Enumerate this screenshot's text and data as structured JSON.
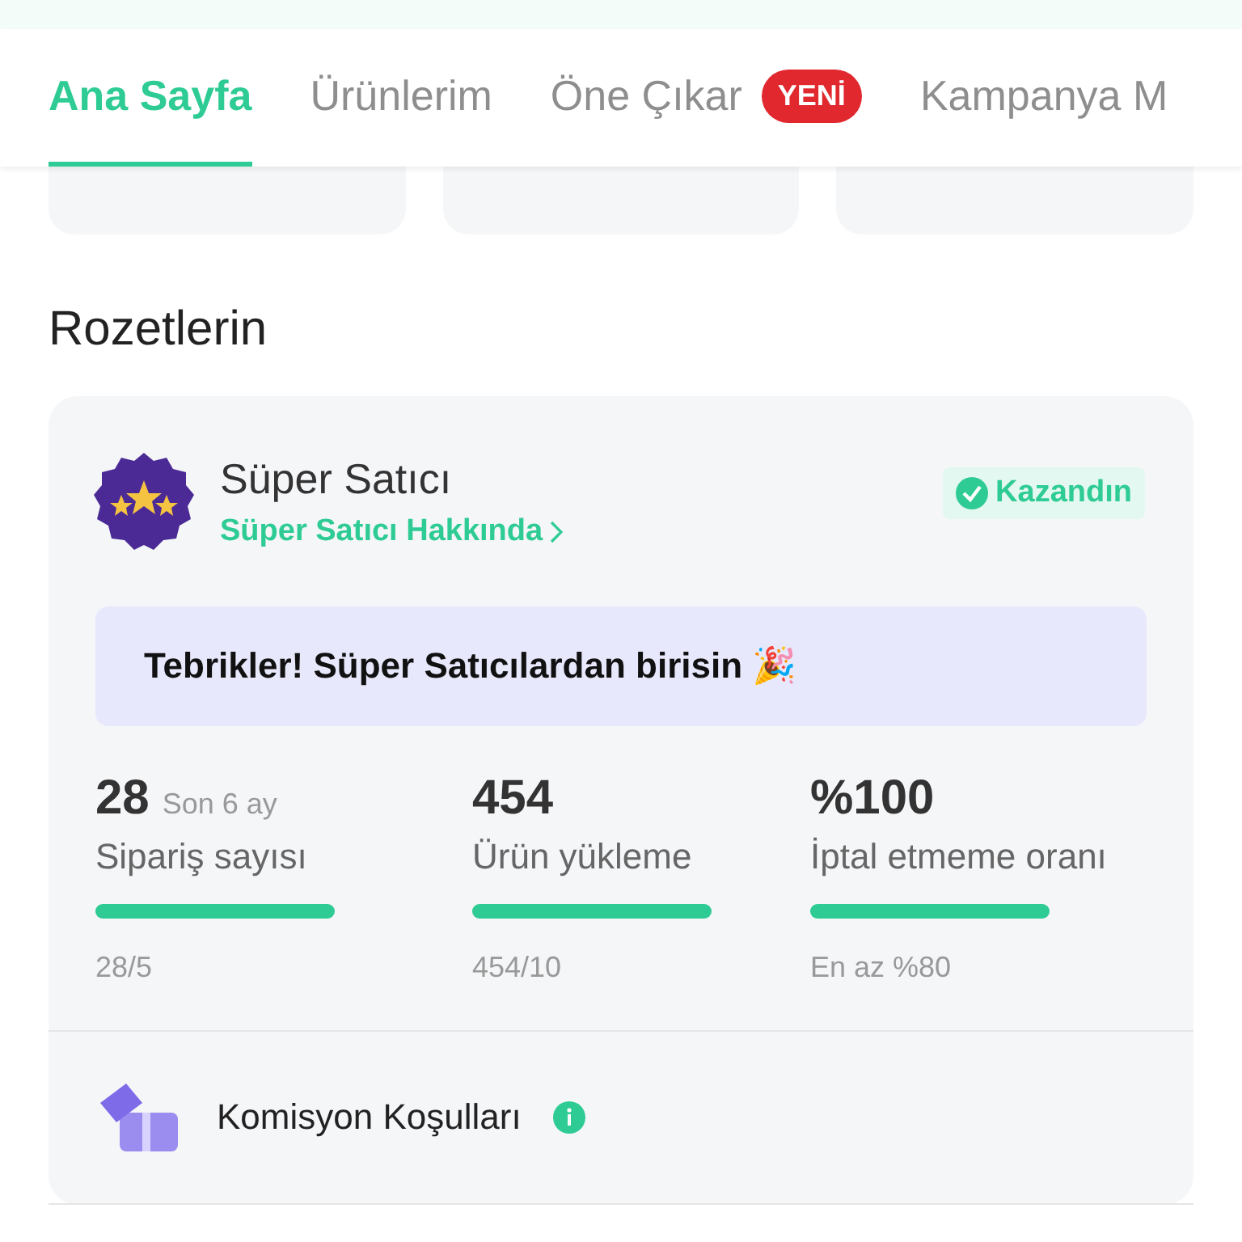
{
  "tabs": [
    {
      "label": "Ana Sayfa",
      "selected": true
    },
    {
      "label": "Ürünlerim",
      "selected": false
    },
    {
      "label": "Öne Çıkar",
      "selected": false,
      "badge": "YENİ"
    },
    {
      "label": "Kampanya M",
      "selected": false
    }
  ],
  "summary_cards": [
    {
      "kind": "stat"
    },
    {
      "kind": "stat"
    },
    {
      "kind": "stat"
    }
  ],
  "section_title": "Rozetlerin",
  "badge_card": {
    "title": "Süper Satıcı",
    "link": "Süper Satıcı Hakkında",
    "status": "Kazandın",
    "banner": "Tebrikler! Süper Satıcılardan birisin 🎉",
    "metrics": [
      {
        "value": "28",
        "note": "Son 6 ay",
        "label": "Sipariş sayısı",
        "level": 1,
        "detail": "28/5"
      },
      {
        "value": "454",
        "label": "Ürün yükleme",
        "level": 1,
        "detail": "454/10"
      },
      {
        "value": "%100",
        "label": "İptal etmeme oranı",
        "level": 1,
        "detail": "En az %80"
      }
    ],
    "commission": "Komisyon Koşulları"
  }
}
